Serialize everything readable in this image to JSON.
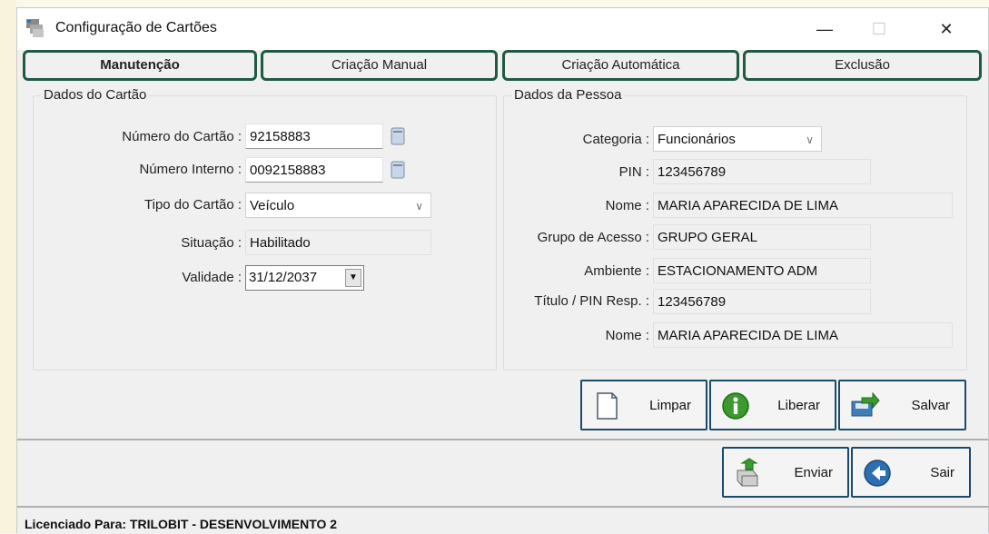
{
  "window": {
    "title": "Configuração de Cartões",
    "controls": {
      "minimize": "—",
      "maximize": "☐",
      "close": "✕"
    }
  },
  "tabs": [
    {
      "label": "Manutenção",
      "active": true
    },
    {
      "label": "Criação Manual",
      "active": false
    },
    {
      "label": "Criação Automática",
      "active": false
    },
    {
      "label": "Exclusão",
      "active": false
    }
  ],
  "card": {
    "group_title": "Dados do Cartão",
    "numero_label": "Número do Cartão :",
    "numero_value": "92158883",
    "interno_label": "Número Interno :",
    "interno_value": "0092158883",
    "tipo_label": "Tipo do Cartão :",
    "tipo_value": "Veículo",
    "situacao_label": "Situação :",
    "situacao_value": "Habilitado",
    "validade_label": "Validade :",
    "validade_value": "31/12/2037"
  },
  "person": {
    "group_title": "Dados da Pessoa",
    "categoria_label": "Categoria :",
    "categoria_value": "Funcionários",
    "pin_label": "PIN :",
    "pin_value": "123456789",
    "nome_label": "Nome :",
    "nome_value": "MARIA APARECIDA DE LIMA",
    "grupo_label": "Grupo de Acesso :",
    "grupo_value": "GRUPO GERAL",
    "ambiente_label": "Ambiente :",
    "ambiente_value": "ESTACIONAMENTO ADM",
    "titulo_label": "Título / PIN Resp. :",
    "titulo_value": "123456789",
    "nome_resp_label": "Nome :",
    "nome_resp_value": "MARIA APARECIDA DE LIMA"
  },
  "actions": {
    "limpar": "Limpar",
    "liberar": "Liberar",
    "salvar": "Salvar",
    "enviar": "Enviar",
    "sair": "Sair"
  },
  "status": {
    "text": "Licenciado Para: TRILOBIT - DESENVOLVIMENTO 2"
  },
  "colors": {
    "tab_border": "#1f5a43",
    "button_border": "#1b4a6a",
    "background": "#f0f0f0"
  },
  "icons": {
    "app": "app-cards-icon",
    "lookup": "lookup-card-icon",
    "limpar": "blank-page-icon",
    "liberar": "info-icon",
    "salvar": "save-arrow-icon",
    "enviar": "send-box-icon",
    "sair": "exit-arrow-icon"
  }
}
